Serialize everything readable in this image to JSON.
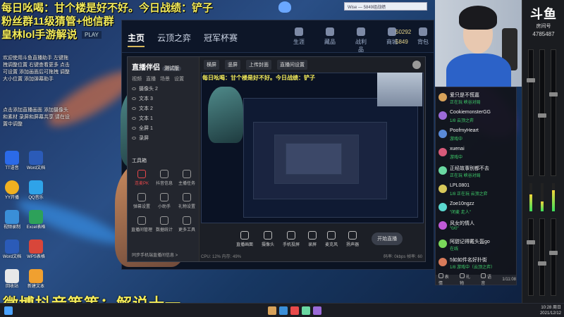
{
  "overlay": {
    "line1": "每日吆喝：甘个楼是好不好。今日战绩：铲子",
    "line2": "粉丝群11级猜管+他信群",
    "line3": "皇林lol手游解说",
    "play_badge": "PLAY",
    "bottom": "微博抖音等等：解说十一"
  },
  "client": {
    "nav": [
      "主页",
      "云顶之弈",
      "冠军杯赛"
    ],
    "icons": [
      "生涯",
      "藏品",
      "战利品",
      "商城",
      "背包"
    ],
    "coins": [
      "50292",
      "5849"
    ]
  },
  "login_window": {
    "title": "Wise — 5849组战绩"
  },
  "banzhu": {
    "logo": "直播伴侣",
    "beta": "测试版",
    "tabs": [
      "视频",
      "直播",
      "场景",
      "设置"
    ],
    "scenes": [
      "摄像头 2",
      "文本 3",
      "文本 2",
      "文本 1",
      "全屏 1",
      "录屏"
    ],
    "tools_title": "工具箱",
    "tools": [
      {
        "label": "连麦PK",
        "accent": true
      },
      {
        "label": "抖音信息",
        "accent": false
      },
      {
        "label": "主播任务",
        "accent": false
      },
      {
        "label": "弹幕设置",
        "accent": false
      },
      {
        "label": "小助手",
        "accent": false
      },
      {
        "label": "礼物设置",
        "accent": false
      },
      {
        "label": "直播间管理",
        "accent": false
      },
      {
        "label": "数据统计",
        "accent": false
      },
      {
        "label": "更多工具",
        "accent": false
      }
    ],
    "footer": "同步手机端直播间信息 >",
    "topbar": [
      "横屏",
      "竖屏",
      "上传封面",
      "直播间设置"
    ],
    "bottom_buttons": [
      "直播画面",
      "摄像头",
      "手机投屏",
      "录屏",
      "麦克风",
      "扬声器"
    ],
    "start_label": "开始直播",
    "status_left": "CPU: 12%  内存: 49%",
    "status_right": "码率: 0kbps  帧率: 60"
  },
  "side_notes": {
    "block1": "欢迎使用斗鱼直播助手 左键拖拽调整位置 右键查看更多 点击可设置 添加画面后可拖拽 调整大小位置 添加弹幕助手",
    "block2": "点击添加直播画面 添加摄像头和素材 录屏和屏幕共享 请在设置中调整"
  },
  "desktop_icons": [
    "TT语音",
    "Word文档",
    "YY开播",
    "QQ音乐",
    "视频录制",
    "Excel表格",
    "Word文档",
    "WPS表格",
    "回收站",
    "新建文本"
  ],
  "mixer": {
    "logo": "斗鱼",
    "label": "房间号",
    "room_id": "4785487"
  },
  "chat": [
    {
      "name": "爱只是不慌嘉",
      "sub": "正在玩 峡谷对局",
      "color": "#d8a25a"
    },
    {
      "name": "CookiemonsterGG",
      "sub": "1/8 云顶之弈",
      "color": "#9b6ad8"
    },
    {
      "name": "PoofmyHeart",
      "sub": "游戏中",
      "color": "#5a8ad8"
    },
    {
      "name": "xuenai",
      "sub": "游戏中",
      "color": "#d85a7a"
    },
    {
      "name": "正经故事别都不去",
      "sub": "正在玩 峡谷对局",
      "color": "#6ad8a2"
    },
    {
      "name": "LPL0801",
      "sub": "1/8 正在玩 云顶之弈",
      "color": "#d8c85a"
    },
    {
      "name": "Zoe10ngzz",
      "sub": "\"闭麦 走人\"",
      "color": "#5ad8d0"
    },
    {
      "name": "风女的情人",
      "sub": "\"0/0\"",
      "color": "#c05ad8"
    },
    {
      "name": "阿甜记得戴头盔go",
      "sub": "在线",
      "color": "#7ad85a"
    },
    {
      "name": "5如如件名好扑街",
      "sub": "1/8 游戏中（云顶之弈）",
      "color": "#d87a5a"
    }
  ],
  "chat_bar": [
    "表情",
    "礼物",
    "语音",
    "1/11:08"
  ],
  "taskbar": {
    "time": "10:28 周日",
    "date": "2021/12/12"
  }
}
